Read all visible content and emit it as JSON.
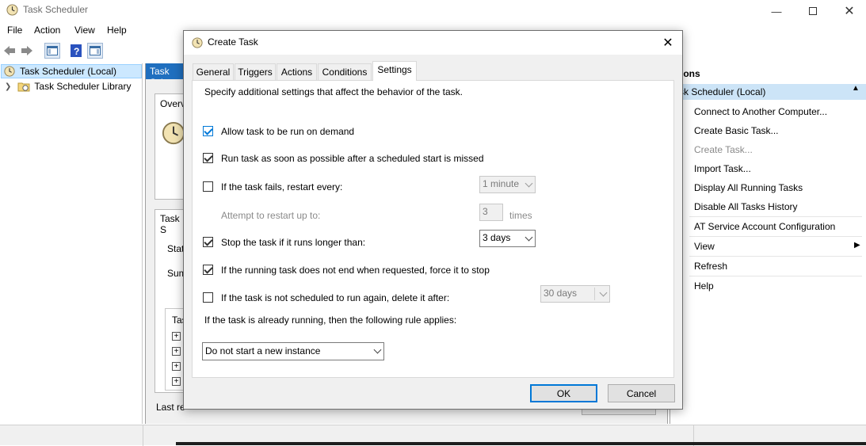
{
  "window": {
    "title": "Task Scheduler",
    "menu": [
      "File",
      "Action",
      "View",
      "Help"
    ],
    "controls": [
      "minimize-icon",
      "maximize-icon",
      "close-icon"
    ]
  },
  "tree": {
    "root": "Task Scheduler (Local)",
    "library": "Task Scheduler Library"
  },
  "middle": {
    "header": "Task Sch",
    "overview_tab": "Overv",
    "status_section": "Task S",
    "status_label": "Stat",
    "summary_label": "Sum",
    "tasks_label": "Tas",
    "last_refreshed": "Last re"
  },
  "actions": {
    "title": "tions",
    "section": "sk Scheduler (Local)",
    "items": [
      {
        "label": "Connect to Another Computer...",
        "enabled": true
      },
      {
        "label": "Create Basic Task...",
        "enabled": true
      },
      {
        "label": "Create Task...",
        "enabled": false
      },
      {
        "label": "Import Task...",
        "enabled": true
      },
      {
        "label": "Display All Running Tasks",
        "enabled": true
      },
      {
        "label": "Disable All Tasks History",
        "enabled": true
      },
      {
        "label": "AT Service Account Configuration",
        "enabled": true
      },
      {
        "label": "View",
        "enabled": true
      },
      {
        "label": "Refresh",
        "enabled": true
      },
      {
        "label": "Help",
        "enabled": true
      }
    ]
  },
  "dialog": {
    "title": "Create Task",
    "tabs": [
      "General",
      "Triggers",
      "Actions",
      "Conditions",
      "Settings"
    ],
    "active_tab": "Settings",
    "description": "Specify additional settings that affect the behavior of the task.",
    "settings": {
      "allow_on_demand": {
        "label": "Allow task to be run on demand",
        "checked": true
      },
      "run_asap": {
        "label": "Run task as soon as possible after a scheduled start is missed",
        "checked": true
      },
      "restart_on_fail": {
        "label": "If the task fails, restart every:",
        "checked": false,
        "value": "1 minute"
      },
      "restart_attempts": {
        "label": "Attempt to restart up to:",
        "value": "3",
        "unit": "times"
      },
      "stop_if_longer": {
        "label": "Stop the task if it runs longer than:",
        "checked": true,
        "value": "3 days"
      },
      "force_stop": {
        "label": "If the running task does not end when requested, force it to stop",
        "checked": true
      },
      "delete_after": {
        "label": "If the task is not scheduled to run again, delete it after:",
        "checked": false,
        "value": "30 days"
      },
      "rule_label": "If the task is already running, then the following rule applies:",
      "rule_value": "Do not start a new instance"
    },
    "ok": "OK",
    "cancel": "Cancel"
  }
}
